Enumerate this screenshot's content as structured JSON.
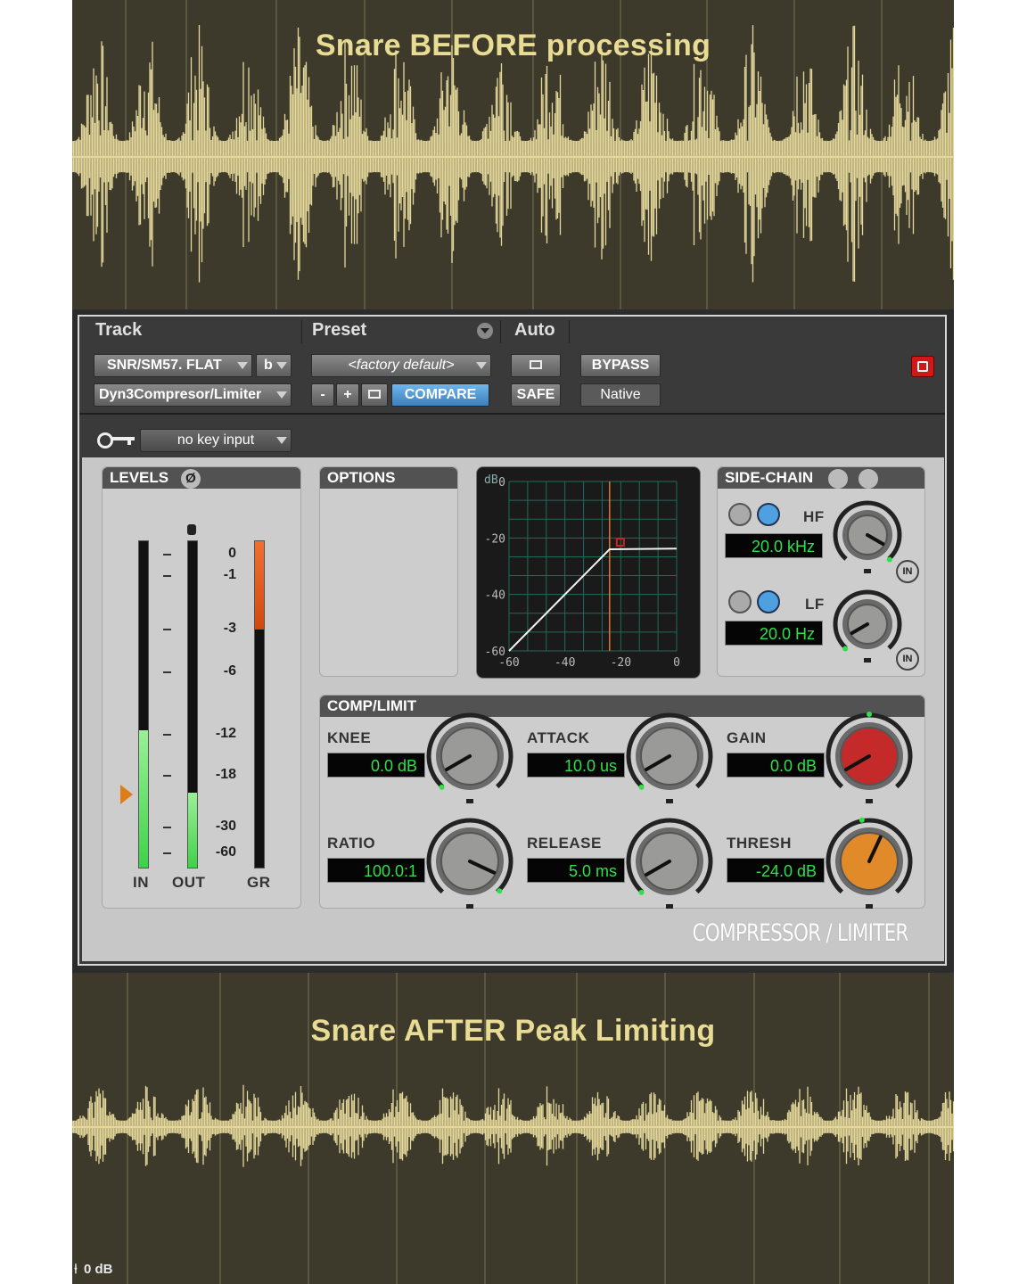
{
  "before": {
    "title": "Snare BEFORE processing"
  },
  "after": {
    "title": "Snare AFTER Peak Limiting",
    "db_readout": "0 dB"
  },
  "header": {
    "track": "Track",
    "preset": "Preset",
    "auto": "Auto"
  },
  "track": {
    "name": "SNR/SM57. FLAT",
    "channel": "b",
    "plugin": "Dyn3Compresor/Limiter"
  },
  "preset": {
    "value": "<factory default>",
    "minus": "-",
    "plus": "+",
    "compare": "COMPARE"
  },
  "auto": {
    "safe": "SAFE"
  },
  "bypass": "BYPASS",
  "native": "Native",
  "key_input": "no key input",
  "levels": {
    "title": "LEVELS",
    "scale": [
      "0",
      "-1",
      "-3",
      "-6",
      "-12",
      "-18",
      "-30",
      "-60"
    ],
    "in_label": "IN",
    "out_label": "OUT",
    "gr_label": "GR",
    "in_level": 0.42,
    "out_level": 0.23,
    "gr_level": 0.27
  },
  "options": {
    "title": "OPTIONS"
  },
  "graph": {
    "db_label": "dB",
    "y_ticks": [
      "0",
      "-20",
      "-40",
      "-60"
    ],
    "x_ticks": [
      "-60",
      "-40",
      "-20",
      "0"
    ],
    "threshold_db": -24,
    "ratio": 100
  },
  "sidechain": {
    "title": "SIDE-CHAIN",
    "hf_label": "HF",
    "hf_value": "20.0 kHz",
    "lf_label": "LF",
    "lf_value": "20.0 Hz",
    "in_label": "IN"
  },
  "comp": {
    "title": "COMP/LIMIT",
    "knee_label": "KNEE",
    "knee_value": "0.0 dB",
    "attack_label": "ATTACK",
    "attack_value": "10.0 us",
    "gain_label": "GAIN",
    "gain_value": "0.0 dB",
    "ratio_label": "RATIO",
    "ratio_value": "100.0:1",
    "release_label": "RELEASE",
    "release_value": "5.0 ms",
    "thresh_label": "THRESH",
    "thresh_value": "-24.0 dB"
  },
  "brand": "COMPRESSOR / LIMITER",
  "colors": {
    "wave_bg": "#3d3a2b",
    "wave": "#e3d79a",
    "title": "#e8dc94",
    "lcd_text": "#2ee04a",
    "gain_knob": "#c42a2a",
    "thresh_knob": "#e08a2a",
    "meter_green": "#3fd24a",
    "gr_orange": "#e05a10"
  }
}
